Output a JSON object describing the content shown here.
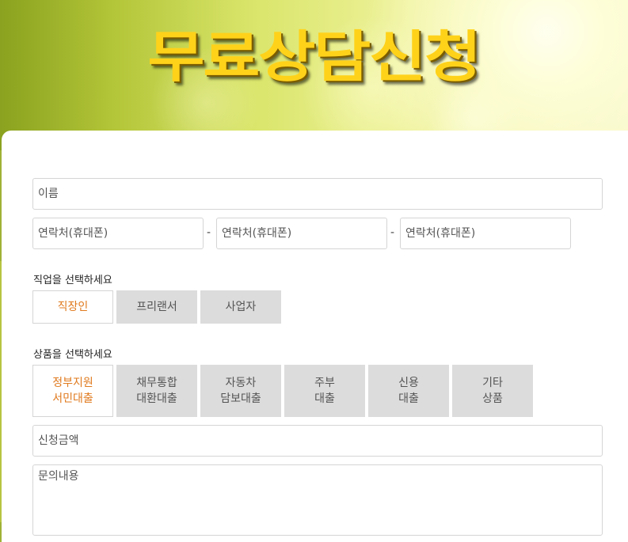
{
  "hero": {
    "title": "무료상담신청"
  },
  "form": {
    "name_placeholder": "이름",
    "phone": {
      "part1_placeholder": "연락처(휴대폰)",
      "part2_placeholder": "연락처(휴대폰)",
      "part3_placeholder": "연락처(휴대폰)",
      "separator": "-"
    },
    "job": {
      "label": "직업을 선택하세요",
      "options": [
        "직장인",
        "프리랜서",
        "사업자"
      ],
      "selected": "직장인"
    },
    "product": {
      "label": "상품을 선택하세요",
      "options": [
        {
          "line1": "정부지원",
          "line2": "서민대출"
        },
        {
          "line1": "채무통합",
          "line2": "대환대출"
        },
        {
          "line1": "자동차",
          "line2": "담보대출"
        },
        {
          "line1": "주부",
          "line2": "대출"
        },
        {
          "line1": "신용",
          "line2": "대출"
        },
        {
          "line1": "기타",
          "line2": "상품"
        }
      ],
      "selected": "정부지원 서민대출"
    },
    "amount_placeholder": "신청금액",
    "inquiry_placeholder": "문의내용"
  },
  "colors": {
    "title_yellow": "#ffd21a",
    "selected_text": "#e07a1e",
    "option_bg": "#dcdcdc"
  }
}
